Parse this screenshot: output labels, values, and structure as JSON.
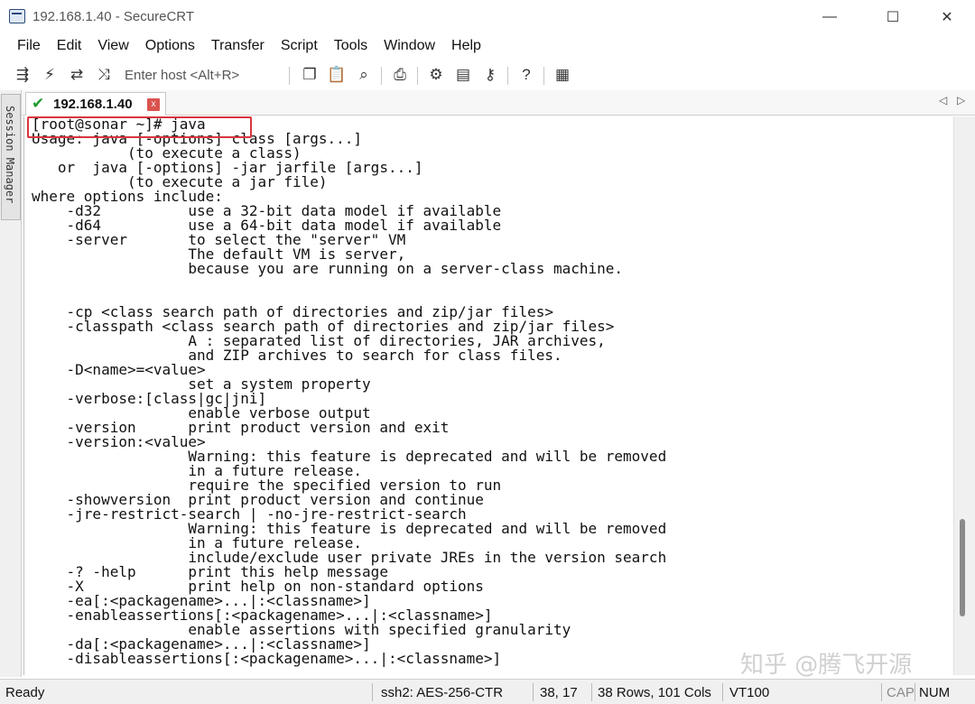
{
  "window": {
    "title": "192.168.1.40 - SecureCRT",
    "controls": {
      "minimize": "—",
      "maximize": "☐",
      "close": "✕"
    }
  },
  "menu": [
    "File",
    "Edit",
    "View",
    "Options",
    "Transfer",
    "Script",
    "Tools",
    "Window",
    "Help"
  ],
  "toolbar": {
    "host_placeholder": "Enter host <Alt+R>",
    "icons": {
      "connect": "⇶",
      "quick_connect": "⚡",
      "reconnect": "⇄",
      "disconnect": "⤨",
      "copy": "❐",
      "paste": "📋",
      "find": "⌕",
      "print": "⎙",
      "settings": "⚙",
      "keymap": "▤",
      "sftp": "⚷",
      "help": "?",
      "map": "▦"
    }
  },
  "session_manager": {
    "label": "Session Manager"
  },
  "tab": {
    "label": "192.168.1.40",
    "check": "✔",
    "close": "x",
    "prev": "◁",
    "next": "▷"
  },
  "terminal": {
    "lines": [
      "[root@sonar ~]# java",
      "Usage: java [-options] class [args...]",
      "           (to execute a class)",
      "   or  java [-options] -jar jarfile [args...]",
      "           (to execute a jar file)",
      "where options include:",
      "    -d32          use a 32-bit data model if available",
      "    -d64          use a 64-bit data model if available",
      "    -server       to select the \"server\" VM",
      "                  The default VM is server,",
      "                  because you are running on a server-class machine.",
      "",
      "",
      "    -cp <class search path of directories and zip/jar files>",
      "    -classpath <class search path of directories and zip/jar files>",
      "                  A : separated list of directories, JAR archives,",
      "                  and ZIP archives to search for class files.",
      "    -D<name>=<value>",
      "                  set a system property",
      "    -verbose:[class|gc|jni]",
      "                  enable verbose output",
      "    -version      print product version and exit",
      "    -version:<value>",
      "                  Warning: this feature is deprecated and will be removed",
      "                  in a future release.",
      "                  require the specified version to run",
      "    -showversion  print product version and continue",
      "    -jre-restrict-search | -no-jre-restrict-search",
      "                  Warning: this feature is deprecated and will be removed",
      "                  in a future release.",
      "                  include/exclude user private JREs in the version search",
      "    -? -help      print this help message",
      "    -X            print help on non-standard options",
      "    -ea[:<packagename>...|:<classname>]",
      "    -enableassertions[:<packagename>...|:<classname>]",
      "                  enable assertions with specified granularity",
      "    -da[:<packagename>...|:<classname>]",
      "    -disableassertions[:<packagename>...|:<classname>]"
    ]
  },
  "watermark": "知乎 @腾飞开源",
  "status": {
    "state": "Ready",
    "cipher": "ssh2: AES-256-CTR",
    "cursor": "38, 17",
    "dims": "38 Rows, 101 Cols",
    "term": "VT100",
    "cap": "CAP",
    "num": "NUM"
  },
  "colors": {
    "highlight": "#d9353f",
    "tab_ok": "#1f9a2e",
    "tab_close": "#d9534f"
  }
}
